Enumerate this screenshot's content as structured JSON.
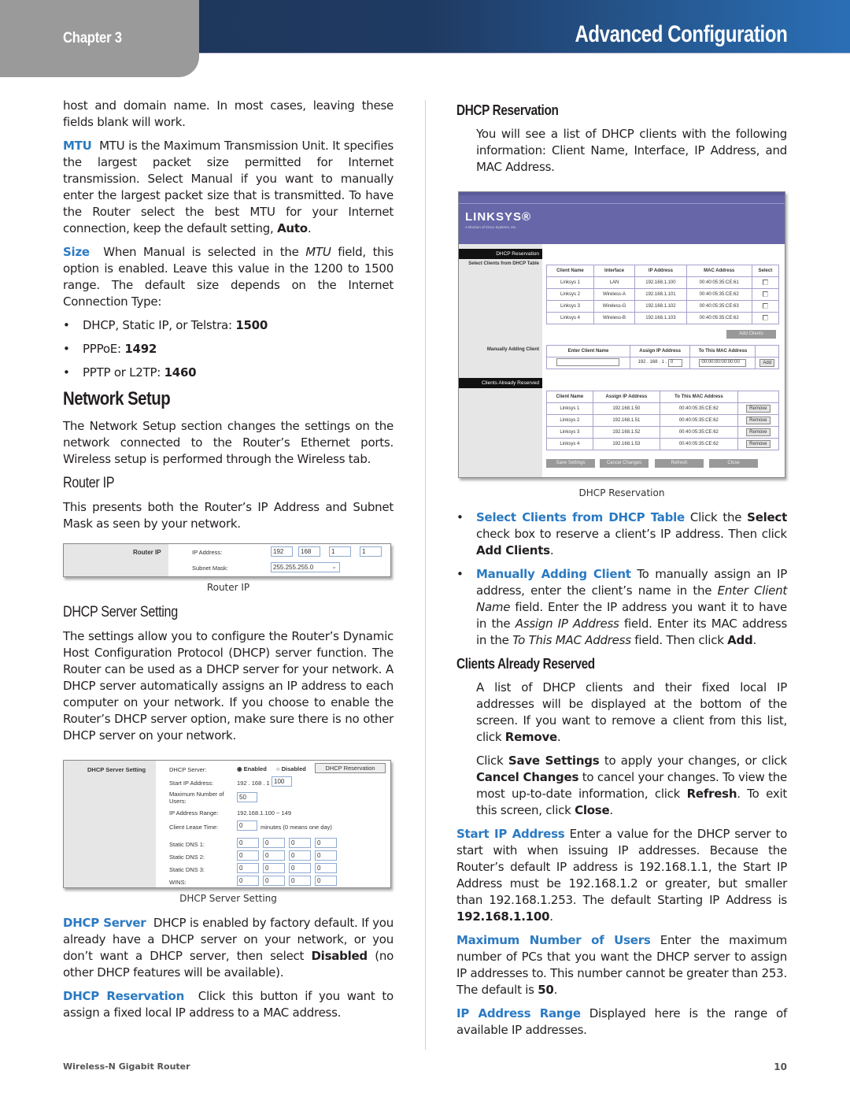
{
  "header": {
    "chapter": "Chapter 3",
    "title": "Advanced Configuration"
  },
  "colors": {
    "accent": "#2b7ac2",
    "header_dark": "#1e3457",
    "header_light": "#2a6fb5",
    "chapter_tab": "#9a9a9b"
  },
  "left": {
    "intro": "host and domain name. In most cases, leaving these fields blank will work.",
    "mtu": {
      "term": "MTU",
      "text": "MTU is the Maximum Transmission Unit. It specifies the largest packet size permitted for Internet transmission. Select Manual if you want to manually enter the largest packet size that is transmitted. To have the Router select the best MTU for your Internet connection, keep the default setting, ",
      "bold": "Auto",
      "end": "."
    },
    "size": {
      "term": "Size",
      "text1": "When Manual is selected in the ",
      "italic": "MTU",
      "text2": " field, this option is enabled. Leave this value in the 1200 to 1500 range. The default size depends on the Internet Connection Type:"
    },
    "size_list": [
      {
        "label": "DHCP, Static IP, or Telstra: ",
        "value": "1500"
      },
      {
        "label": "PPPoE: ",
        "value": "1492"
      },
      {
        "label": "PPTP or L2TP: ",
        "value": "1460"
      }
    ],
    "network_setup": {
      "heading": "Network Setup",
      "text": "The Network Setup section changes the settings on the network connected to the Router’s Ethernet ports. Wireless setup is performed through the Wireless tab."
    },
    "router_ip": {
      "heading": "Router IP",
      "text": "This presents both the Router’s IP Address and Subnet Mask as seen by your network.",
      "figure": {
        "section_label": "Router IP",
        "ip_label": "IP Address:",
        "ip": [
          "192",
          "168",
          "1",
          "1"
        ],
        "mask_label": "Subnet Mask:",
        "mask": "255.255.255.0"
      },
      "caption": "Router IP"
    },
    "dhcp_server_setting": {
      "heading": "DHCP Server Setting",
      "text": "The settings allow you to configure the Router’s Dynamic Host Configuration Protocol (DHCP) server function. The Router can be used as a DHCP server for your network. A DHCP server automatically assigns an IP address to each computer on your network. If you choose to enable the Router’s DHCP server option, make sure there is no other DHCP server on your network.",
      "figure": {
        "section_label": "DHCP Server Setting",
        "server_label": "DHCP Server:",
        "enabled": "Enabled",
        "disabled": "Disabled",
        "reservation_btn": "DHCP Reservation",
        "start_ip_label": "Start IP Address:",
        "start_ip_prefix": "192 . 168 . 1 .",
        "start_ip_last": "100",
        "max_users_label": "Maximum Number of Users:",
        "max_users": "50",
        "range_label": "IP Address Range:",
        "range": "192.168.1.100 ~ 149",
        "lease_label": "Client Lease Time:",
        "lease": "0",
        "lease_unit": "minutes (0 means one day)",
        "dns": [
          {
            "label": "Static DNS 1:",
            "octets": [
              "0",
              "0",
              "0",
              "0"
            ]
          },
          {
            "label": "Static DNS 2:",
            "octets": [
              "0",
              "0",
              "0",
              "0"
            ]
          },
          {
            "label": "Static DNS 3:",
            "octets": [
              "0",
              "0",
              "0",
              "0"
            ]
          },
          {
            "label": "WINS:",
            "octets": [
              "0",
              "0",
              "0",
              "0"
            ]
          }
        ]
      },
      "caption": "DHCP Server Setting"
    },
    "dhcp_server": {
      "term": "DHCP Server",
      "text1": "DHCP is enabled by factory default. If you already have a DHCP server on your network, or you don’t want a DHCP server, then select ",
      "bold": "Disabled",
      "text2": " (no other DHCP features will be available)."
    },
    "dhcp_reservation": {
      "term": "DHCP Reservation",
      "text": "Click this button if you want to assign a fixed local IP address to a MAC address."
    }
  },
  "right": {
    "dhcp_reservation": {
      "heading": "DHCP Reservation",
      "text": "You will see a list of DHCP clients with the following information: Client Name, Interface, IP Address, and MAC Address.",
      "figure": {
        "logo": "LINKSYS®",
        "logo_sub": "A Division of Cisco Systems, Inc.",
        "bar1": "DHCP Reservation",
        "select_label": "Select Clients from DHCP Table",
        "clients_headers": [
          "Client Name",
          "Interface",
          "IP Address",
          "MAC Address",
          "Select"
        ],
        "clients": [
          [
            "Linksys 1",
            "LAN",
            "192.168.1.100",
            "00:40:05:35:CE:61"
          ],
          [
            "Linksys 2",
            "Wireless-A",
            "192.168.1.101",
            "00:40:05:35:CE:62"
          ],
          [
            "Linksys 3",
            "Wireless-G",
            "192.168.1.102",
            "00:40:05:35:CE:63"
          ],
          [
            "Linksys 4",
            "Wireless-B",
            "192.168.1.103",
            "00:40:05:35:CE:62"
          ]
        ],
        "add_clients_btn": "Add Clients",
        "manual_label": "Manually Adding Client",
        "manual_headers": [
          "Enter Client Name",
          "Assign IP Address",
          "To This MAC Address"
        ],
        "manual_ip_prefix": "192 . 168 . 1 .",
        "manual_ip_last": "0",
        "manual_mac": "00:00:00:00:00:00",
        "add_btn": "Add",
        "bar2": "Clients Already Reserved",
        "reserved_headers": [
          "Client Name",
          "Assign IP Address",
          "To This MAC Address"
        ],
        "reserved": [
          [
            "Linksys 1",
            "192.168.1.50",
            "00:40:05:35:CE:62"
          ],
          [
            "Linksys 2",
            "192.168.1.51",
            "00:40:05:35:CE:62"
          ],
          [
            "Linksys 3",
            "192.168.1.52",
            "00:40:05:35:CE:62"
          ],
          [
            "Linksys 4",
            "192.168.1.53",
            "00:40:05:35:CE:62"
          ]
        ],
        "remove_btn": "Remove",
        "buttons": [
          "Save Settings",
          "Cancel Changes",
          "Refresh",
          "Close"
        ]
      },
      "caption": "DHCP Reservation"
    },
    "bullets": {
      "select": {
        "term": "Select Clients from DHCP Table",
        "t1": " Click the ",
        "b1": "Select",
        "t2": " check box to reserve a client’s IP address. Then click ",
        "b2": "Add Clients",
        "t3": "."
      },
      "manual": {
        "term": "Manually Adding Client",
        "t1": " To manually assign an IP address, enter the client’s name in the ",
        "i1": "Enter Client Name",
        "t2": " field. Enter the IP address you want it to have in the ",
        "i2": "Assign IP Address",
        "t3": " field. Enter its MAC address in the ",
        "i3": "To This MAC Address",
        "t4": " field. Then click ",
        "b1": "Add",
        "t5": "."
      }
    },
    "clients_reserved": {
      "heading": "Clients Already Reserved",
      "p1": {
        "t1": "A list of DHCP clients and their fixed local IP addresses will be displayed at the bottom of the screen. If you want to remove a client from this list, click ",
        "b1": "Remove",
        "t2": "."
      },
      "p2": {
        "t1": "Click ",
        "b1": "Save Settings",
        "t2": " to apply your changes, or click ",
        "b2": "Cancel Changes",
        "t3": " to cancel your changes. To view the most up-to-date information, click ",
        "b3": "Refresh",
        "t4": ". To exit this screen, click ",
        "b4": "Close",
        "t5": "."
      }
    },
    "start_ip": {
      "term": "Start IP Address",
      "text": " Enter a value for the DHCP server to start with when issuing IP addresses. Because the Router’s default IP address is 192.168.1.1, the Start IP Address must be 192.168.1.2 or greater, but smaller than 192.168.1.253. The default Starting IP Address is ",
      "bold": "192.168.1.100",
      "end": "."
    },
    "max_users": {
      "term": "Maximum Number of Users",
      "text": " Enter the maximum number of PCs that you want the DHCP server to assign IP addresses to. This number cannot be greater than 253. The default is ",
      "bold": "50",
      "end": "."
    },
    "ip_range": {
      "term": "IP Address Range",
      "text": " Displayed here is the range of available IP addresses."
    }
  },
  "footer": {
    "product": "Wireless-N Gigabit Router",
    "page": "10"
  }
}
